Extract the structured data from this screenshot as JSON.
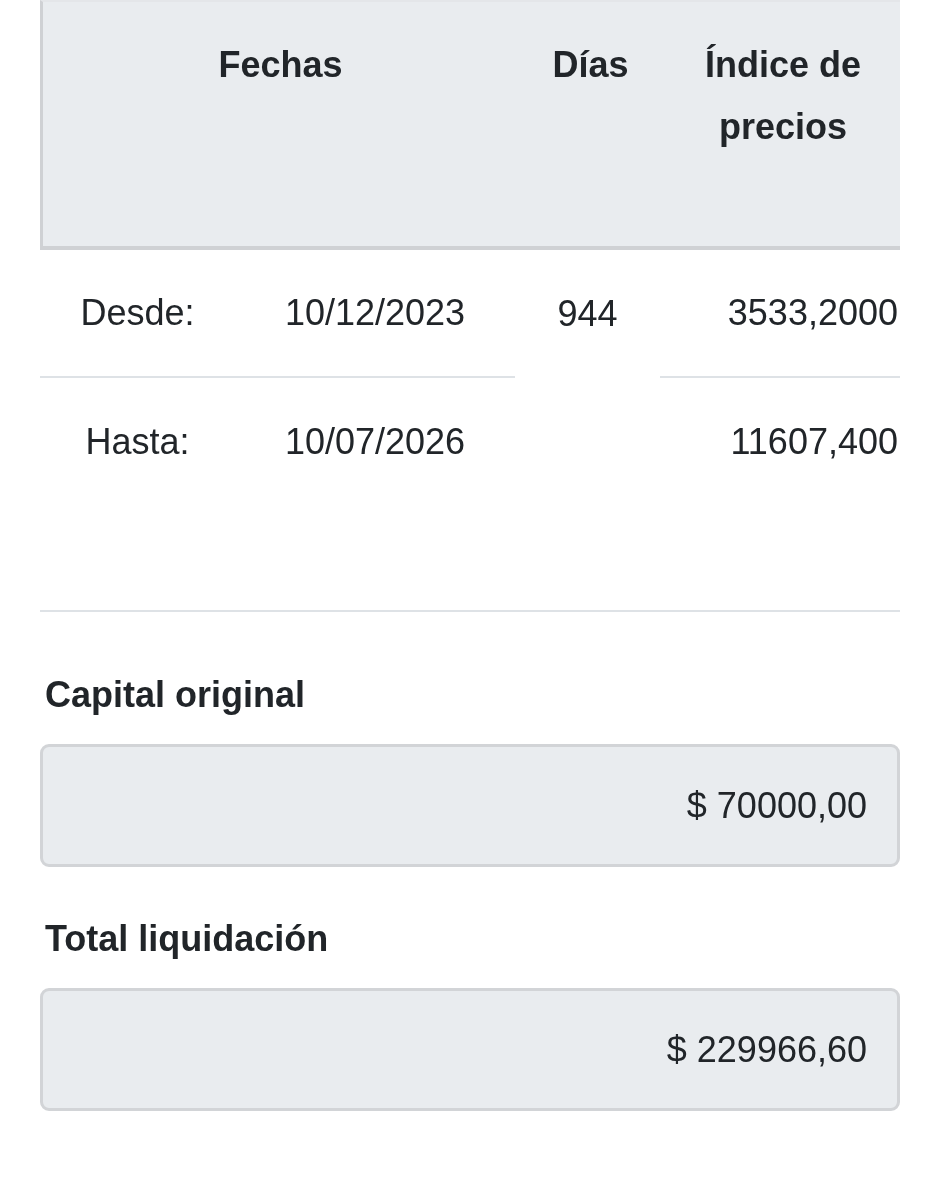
{
  "table": {
    "headers": [
      "Fechas",
      "Días",
      "Índice de precios"
    ],
    "rows": [
      {
        "label": "Desde:",
        "date": "10/12/2023",
        "days": "944",
        "index": "3533,2000"
      },
      {
        "label": "Hasta:",
        "date": "10/07/2026",
        "index": "11607,400"
      }
    ]
  },
  "fields": [
    {
      "label": "Capital original",
      "value": "$ 70000,00"
    },
    {
      "label": "Total liquidación",
      "value": "$ 229966,60"
    }
  ]
}
